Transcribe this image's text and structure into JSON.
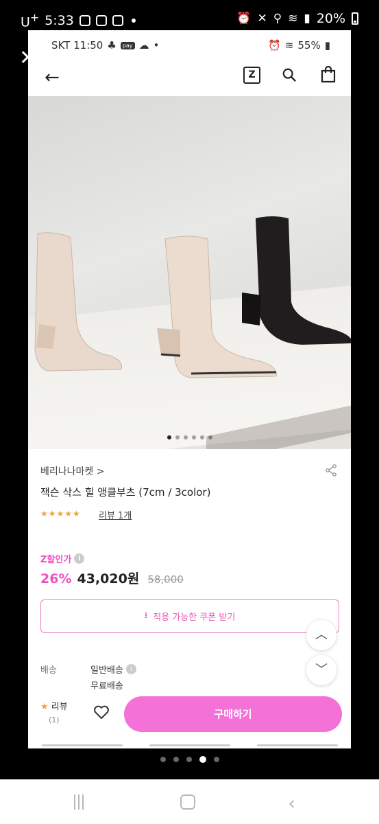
{
  "os_status": {
    "carrier": "U",
    "carrier_sup": "+",
    "time": "5:33",
    "battery": "20%"
  },
  "inner_status": {
    "left": "SKT 11:50",
    "pay": "pay",
    "battery": "55%"
  },
  "appbar": {
    "z_label": "Z"
  },
  "hero": {
    "image_count": 6,
    "active_index": 0
  },
  "product": {
    "brand": "베리나나마켓 >",
    "title": "잭슨 삭스 힐 앵클부츠 (7cm / 3color)",
    "stars": "★★★★★",
    "rating": 5,
    "review_link": "리뷰 1개",
    "z_discount_label": "Z할인가",
    "info_icon": "i",
    "discount_percent": "26%",
    "price": "43,020원",
    "original_price": "58,000",
    "coupon_label": "적용 가능한 쿠폰 받기",
    "coupon_icon": "⭳"
  },
  "shipping": {
    "label": "배송",
    "type": "일반배송",
    "fee": "무료배송"
  },
  "actions": {
    "review_label": "리뷰",
    "review_star": "★",
    "review_count": "(1)",
    "buy_label": "구매하기"
  },
  "outer": {
    "page_count": 5,
    "active_page": 3
  },
  "colors": {
    "accent_pink": "#f04fc1",
    "buy_button": "#f472d8",
    "star": "#f0a33a"
  }
}
